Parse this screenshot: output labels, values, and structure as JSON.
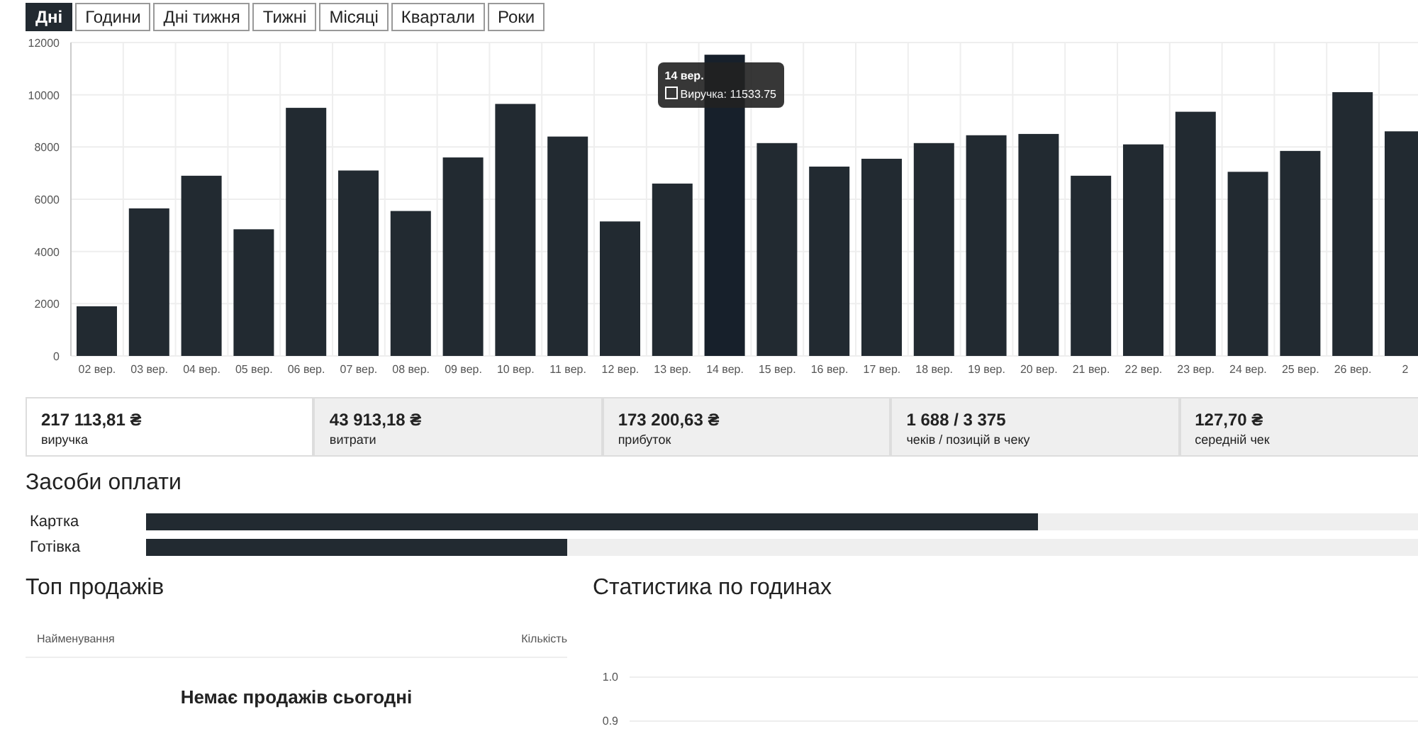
{
  "tabs": [
    {
      "label": "Дні",
      "selected": true
    },
    {
      "label": "Години",
      "selected": false
    },
    {
      "label": "Дні тижня",
      "selected": false
    },
    {
      "label": "Тижні",
      "selected": false
    },
    {
      "label": "Місяці",
      "selected": false
    },
    {
      "label": "Квартали",
      "selected": false
    },
    {
      "label": "Роки",
      "selected": false
    }
  ],
  "revenue_chart": {
    "chart_data": {
      "type": "bar",
      "categories": [
        "02 вер.",
        "03 вер.",
        "04 вер.",
        "05 вер.",
        "06 вер.",
        "07 вер.",
        "08 вер.",
        "09 вер.",
        "10 вер.",
        "11 вер.",
        "12 вер.",
        "13 вер.",
        "14 вер.",
        "15 вер.",
        "16 вер.",
        "17 вер.",
        "18 вер.",
        "19 вер.",
        "20 вер.",
        "21 вер.",
        "22 вер.",
        "23 вер.",
        "24 вер.",
        "25 вер.",
        "26 вер.",
        "2"
      ],
      "series": [
        {
          "name": "Виручка",
          "color": "#222a31",
          "values": [
            1900,
            5650,
            6900,
            4850,
            9500,
            7100,
            5550,
            7600,
            9650,
            8400,
            5150,
            6600,
            11533.75,
            8150,
            7250,
            7550,
            8150,
            8450,
            8500,
            6900,
            8100,
            9350,
            7050,
            7850,
            10100,
            8600
          ]
        }
      ],
      "ylim": [
        0,
        12000
      ],
      "yticks": [
        0,
        2000,
        4000,
        6000,
        8000,
        10000,
        12000
      ],
      "grid": true
    },
    "tooltip": {
      "title": "14 вер.",
      "separator": ":",
      "value": "11533.75"
    }
  },
  "stats": [
    {
      "value": "217 113,81 ₴",
      "label": "виручка",
      "selected": true
    },
    {
      "value": "43 913,18 ₴",
      "label": "витрати",
      "selected": false
    },
    {
      "value": "173 200,63 ₴",
      "label": "прибуток",
      "selected": false
    },
    {
      "value": "1 688 / 3 375",
      "label": "чеків / позицій в чеку",
      "selected": false
    },
    {
      "value": "127,70 ₴",
      "label": "середній чек",
      "selected": false
    }
  ],
  "payments": {
    "title": "Засоби оплати",
    "items": [
      {
        "label": "Картка",
        "level": 0.675
      },
      {
        "label": "Готівка",
        "level": 0.319
      }
    ]
  },
  "top_sales": {
    "title": "Топ продажів",
    "columns": [
      "Найменування",
      "Кількість"
    ],
    "empty_message": "Немає продажів сьогодні"
  },
  "hourly": {
    "title": "Статистика по годинах",
    "yticks": [
      "1.0",
      "0.9"
    ]
  }
}
